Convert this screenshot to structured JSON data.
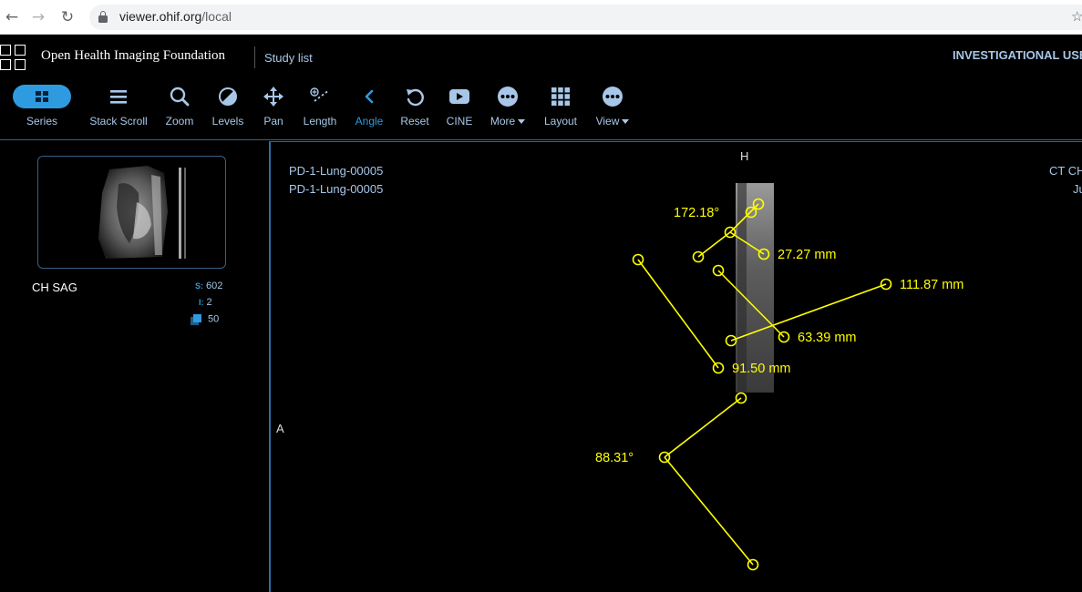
{
  "browser": {
    "back_icon": "arrow-left-icon",
    "forward_icon": "arrow-right-icon",
    "reload_icon": "reload-icon",
    "url_host": "viewer.ohif.org",
    "url_path": "/local"
  },
  "header": {
    "brand": "Open Health Imaging Foundation",
    "study_list": "Study list",
    "banner": "INVESTIGATIONAL USE"
  },
  "toolbar": {
    "accent": "#2e9be0",
    "series": "Series",
    "stack_scroll": "Stack Scroll",
    "zoom": "Zoom",
    "levels": "Levels",
    "pan": "Pan",
    "length": "Length",
    "angle": "Angle",
    "reset": "Reset",
    "cine": "CINE",
    "more": "More",
    "layout": "Layout",
    "view": "View",
    "active_tool": "Angle"
  },
  "series_panel": {
    "description": "CH SAG",
    "series_label": "S:",
    "series_number": "602",
    "instance_label": "I:",
    "instance_number": "2",
    "image_count": "50"
  },
  "viewport": {
    "patient_name": "PD-1-Lung-00005",
    "patient_id": "PD-1-Lung-00005",
    "study_desc_partial": "CT CH",
    "date_partial": "Ju",
    "orientation_top": "H",
    "orientation_left": "A",
    "annotation_color": "#ffff00",
    "measurements": {
      "angle1": "172.18°",
      "length1": "27.27 mm",
      "length2": "111.87 mm",
      "length3": "63.39 mm",
      "length4": "91.50 mm",
      "angle2": "88.31°"
    }
  }
}
